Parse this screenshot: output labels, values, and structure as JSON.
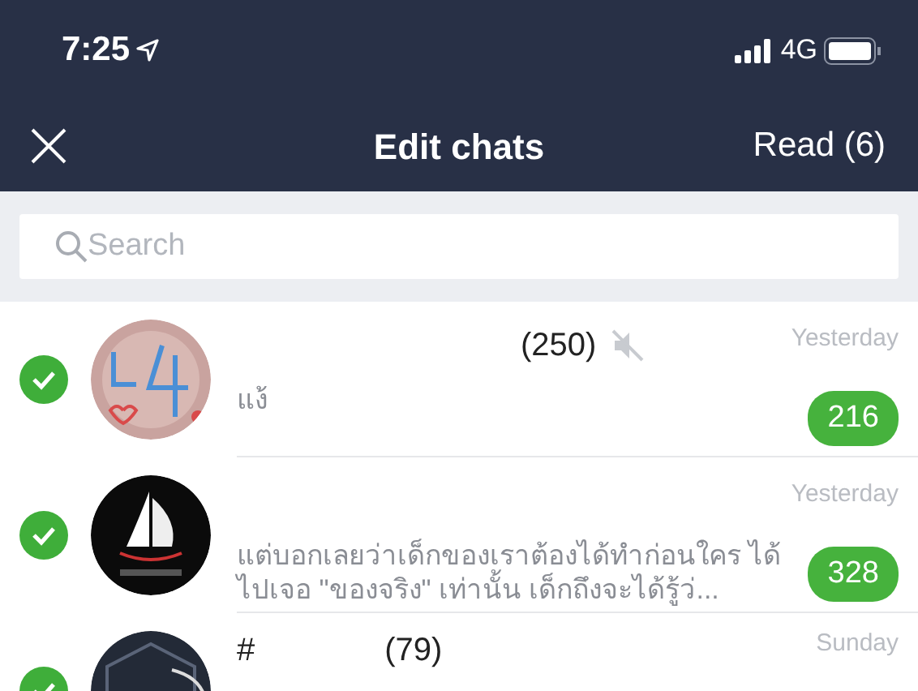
{
  "status_bar": {
    "time": "7:25",
    "network": "4G"
  },
  "nav": {
    "title": "Edit chats",
    "action": "Read (6)"
  },
  "search": {
    "placeholder": "Search"
  },
  "chats": [
    {
      "selected": true,
      "count": "(250)",
      "muted": true,
      "preview": "แง้",
      "time": "Yesterday",
      "unread": "216"
    },
    {
      "selected": true,
      "preview": "แต่บอกเลยว่าเด็กของเราต้องได้ทำก่อนใคร ได้ไปเจอ \"ของจริง\" เท่านั้น เด็กถึงจะได้รู้ว่...",
      "time": "Yesterday",
      "unread": "328"
    },
    {
      "selected": true,
      "name": "#",
      "count": "(79)",
      "time": "Sunday"
    }
  ]
}
